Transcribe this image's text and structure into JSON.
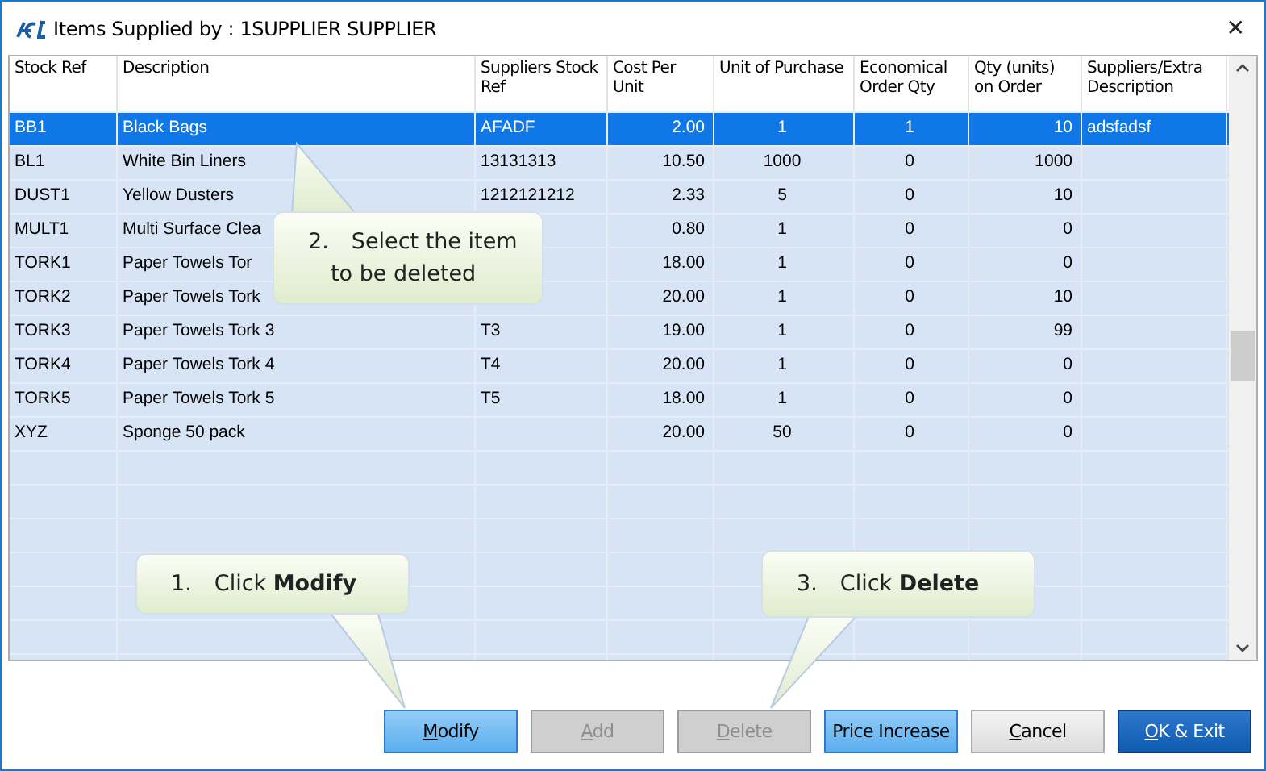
{
  "window": {
    "title": "Items Supplied by : 1SUPPLIER  SUPPLIER",
    "close": "✕"
  },
  "table": {
    "columns": [
      "Stock Ref",
      "Description",
      "Suppliers Stock Ref",
      "Cost Per Unit",
      "Unit of Purchase",
      "Economical Order Qty",
      "Qty (units) on Order",
      "Suppliers/Extra Description"
    ],
    "rows": [
      {
        "cells": [
          "BB1",
          "Black Bags",
          "AFADF",
          "2.00",
          "1",
          "1",
          "10",
          "adsfadsf"
        ],
        "selected": true
      },
      {
        "cells": [
          "BL1",
          "White Bin Liners",
          "13131313",
          "10.50",
          "1000",
          "0",
          "1000",
          ""
        ],
        "selected": false
      },
      {
        "cells": [
          "DUST1",
          "Yellow Dusters",
          "1212121212",
          "2.33",
          "5",
          "0",
          "10",
          ""
        ],
        "selected": false
      },
      {
        "cells": [
          "MULT1",
          "Multi Surface Clea",
          "",
          "0.80",
          "1",
          "0",
          "0",
          ""
        ],
        "selected": false
      },
      {
        "cells": [
          "TORK1",
          "Paper Towels Tor",
          "",
          "18.00",
          "1",
          "0",
          "0",
          ""
        ],
        "selected": false
      },
      {
        "cells": [
          "TORK2",
          "Paper Towels Tork",
          "",
          "20.00",
          "1",
          "0",
          "10",
          ""
        ],
        "selected": false
      },
      {
        "cells": [
          "TORK3",
          "Paper Towels Tork 3",
          "T3",
          "19.00",
          "1",
          "0",
          "99",
          ""
        ],
        "selected": false
      },
      {
        "cells": [
          "TORK4",
          "Paper Towels Tork 4",
          "T4",
          "20.00",
          "1",
          "0",
          "0",
          ""
        ],
        "selected": false
      },
      {
        "cells": [
          "TORK5",
          "Paper Towels Tork 5",
          "T5",
          "18.00",
          "1",
          "0",
          "0",
          ""
        ],
        "selected": false
      },
      {
        "cells": [
          "XYZ",
          "Sponge 50 pack",
          "",
          "20.00",
          "50",
          "0",
          "0",
          ""
        ],
        "selected": false
      }
    ]
  },
  "buttons": [
    {
      "label": "Modify",
      "underline": true,
      "kind": "highlight",
      "disabled": false
    },
    {
      "label": "Add",
      "underline": true,
      "kind": "normal",
      "disabled": true
    },
    {
      "label": "Delete",
      "underline": true,
      "kind": "normal",
      "disabled": true
    },
    {
      "label": "Price Increase",
      "underline": false,
      "kind": "highlight",
      "disabled": false
    },
    {
      "label": "Cancel",
      "underline": true,
      "kind": "normal",
      "disabled": false
    },
    {
      "label": "OK & Exit",
      "underline": true,
      "kind": "default",
      "disabled": false
    }
  ],
  "callouts": [
    {
      "number": "2.",
      "text": "Select the item",
      "text2": "to be deleted"
    },
    {
      "number": "1.",
      "text": "Click **Modify**"
    },
    {
      "number": "3.",
      "text": "Click **Delete**"
    }
  ]
}
